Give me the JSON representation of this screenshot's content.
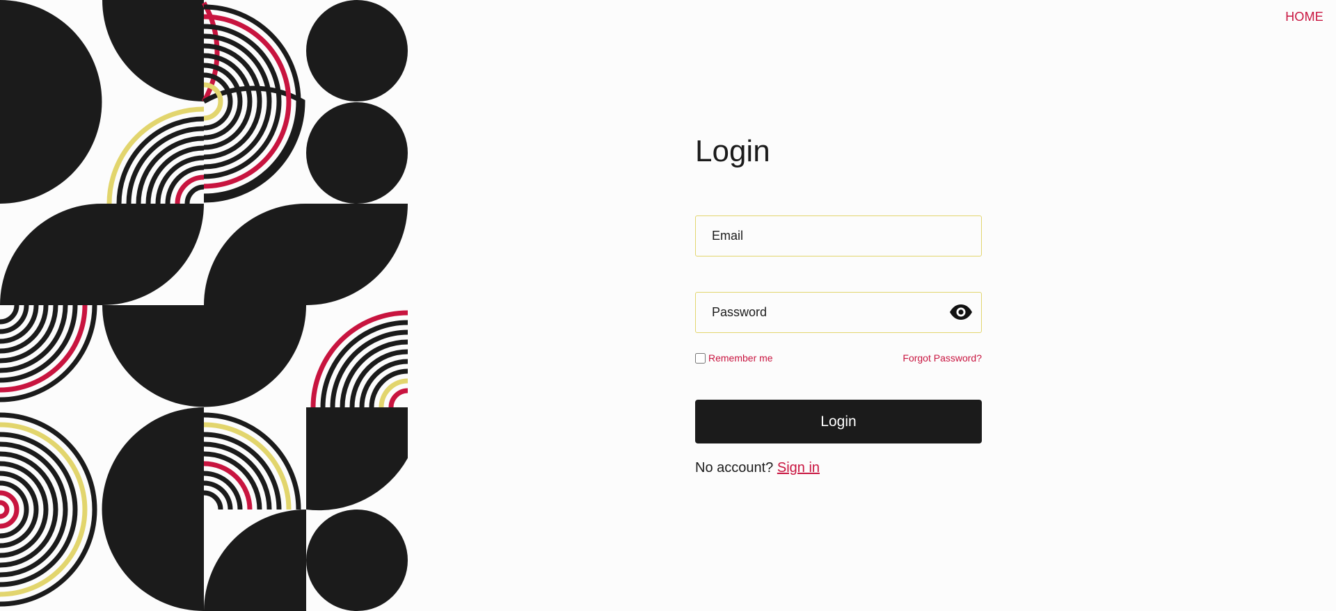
{
  "nav": {
    "home_label": "HOME"
  },
  "login": {
    "title": "Login",
    "email_placeholder": "Email",
    "password_placeholder": "Password",
    "remember_label": "Remember me",
    "forgot_label": "Forgot Password?",
    "submit_label": "Login",
    "no_account_text": "No account?",
    "signin_label": "Sign in"
  },
  "colors": {
    "dark": "#1b1b1b",
    "accent_red": "#c8143f",
    "accent_yellow": "#e2d56d",
    "background": "#fcfcfc"
  },
  "icons": {
    "password_toggle": "eye-icon"
  }
}
